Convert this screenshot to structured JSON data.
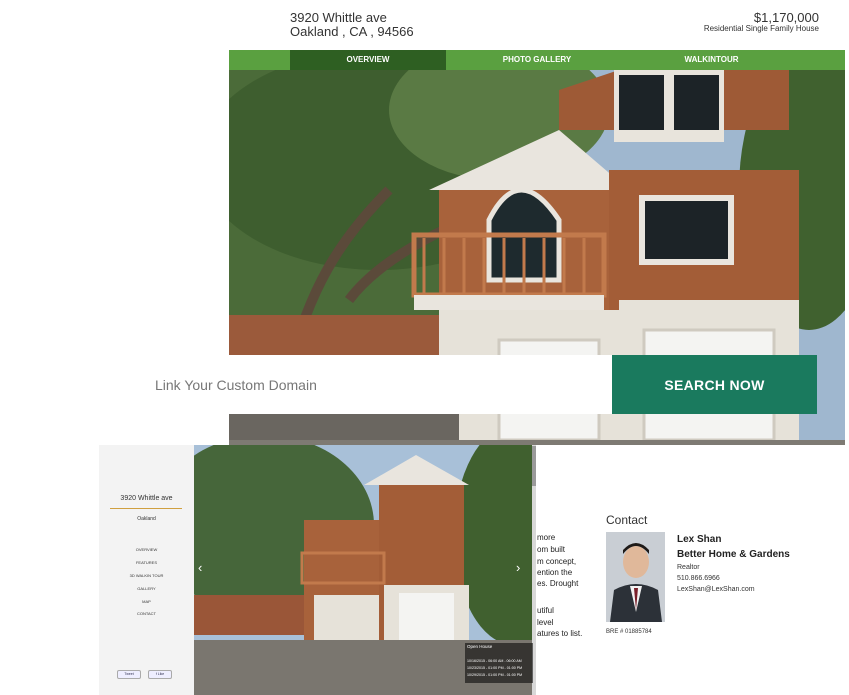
{
  "property": {
    "street": "3920 Whittle ave",
    "city_line": "Oakland , CA , 94566",
    "price": "$1,170,000",
    "type": "Residential Single Family House"
  },
  "nav": {
    "tabs": [
      "OVERVIEW",
      "PHOTO GALLERY",
      "WALKINTOUR"
    ],
    "active": "OVERVIEW"
  },
  "domain_search": {
    "placeholder": "Link Your Custom Domain",
    "button": "SEARCH NOW"
  },
  "mockup": {
    "sidebar": {
      "title": "3920 Whittle ave",
      "city": "Oakland",
      "items": [
        "OVERVIEW",
        "FEATURES",
        "3D WALKIN TOUR",
        "GALLERY",
        "MAP",
        "CONTACT"
      ],
      "social": [
        "Tweet",
        "f Like"
      ]
    },
    "open_house": {
      "title": "Open House",
      "rows": [
        "10/16/2015 - 06:00 AM - 06:00 AM",
        "10/23/2015 - 01:00 PM - 01:00 PM",
        "10/29/2015 - 01:00 PM - 01:00 PM"
      ]
    },
    "description_lines": [
      "more",
      "om built",
      "m concept,",
      "ention the",
      "es. Drought",
      "utiful",
      "level",
      "atures to list."
    ],
    "contact": {
      "heading": "Contact",
      "name": "Lex Shan",
      "company": "Better Home & Gardens",
      "role": "Realtor",
      "phone": "510.866.6966",
      "email": "LexShan@LexShan.com",
      "bre": "BRE  #  01885784"
    }
  },
  "colors": {
    "nav_green": "#5aa040",
    "nav_active": "#2e5f22",
    "search_button": "#1a7a5e"
  }
}
